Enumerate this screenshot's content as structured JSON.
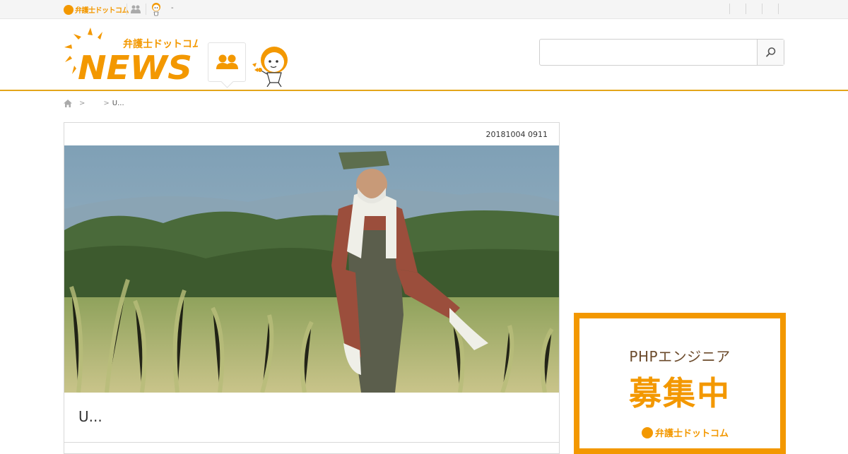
{
  "topbar": {
    "logo_text": "弁護士ドットコム",
    "people_icon": "people-icon",
    "mascot_icon": "mascot-icon",
    "dash": "-"
  },
  "header": {
    "logo_small_text": "弁護士ドットコム",
    "logo_main_text": "NEWS",
    "people_icon": "people-icon",
    "mascot_icon": "mascot-icon",
    "search": {
      "value": "",
      "placeholder": "",
      "button_icon": "search-icon"
    }
  },
  "breadcrumb": {
    "home_icon": "home-icon",
    "sep1": ">",
    "sep2": ">",
    "current": "U..."
  },
  "article": {
    "date": "20181004 0911",
    "title": "U..."
  },
  "ad": {
    "line1": "PHPエンジニア",
    "line2": "募集中",
    "logo_text": "弁護士ドットコム"
  },
  "colors": {
    "brand_orange": "#f39800",
    "header_border": "#e3a51a",
    "ad_text_brown": "#6b4a2b"
  }
}
